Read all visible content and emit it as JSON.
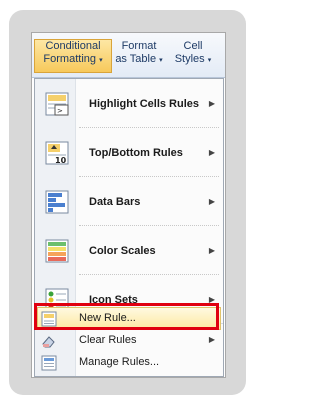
{
  "ribbon": {
    "conditional_formatting": {
      "line1": "Conditional",
      "line2": "Formatting"
    },
    "format_as_table": {
      "line1": "Format",
      "line2": "as Table"
    },
    "cell_styles": {
      "line1": "Cell",
      "line2": "Styles"
    },
    "dropdown_caret": "▾"
  },
  "menu": {
    "items": [
      {
        "label": "Highlight Cells Rules",
        "icon": "highlight-cells-rules-icon",
        "submenu_arrow": "▶"
      },
      {
        "label": "Top/Bottom Rules",
        "icon": "top-bottom-rules-icon",
        "submenu_arrow": "▶"
      },
      {
        "label": "Data Bars",
        "icon": "data-bars-icon",
        "submenu_arrow": "▶"
      },
      {
        "label": "Color Scales",
        "icon": "color-scales-icon",
        "submenu_arrow": "▶"
      },
      {
        "label": "Icon Sets",
        "icon": "icon-sets-icon",
        "submenu_arrow": "▶"
      }
    ],
    "small_items": [
      {
        "label": "New Rule...",
        "icon": "new-rule-icon",
        "highlighted": true
      },
      {
        "label": "Clear Rules",
        "icon": "clear-rules-icon",
        "submenu_arrow": "▶"
      },
      {
        "label": "Manage Rules...",
        "icon": "manage-rules-icon"
      }
    ]
  },
  "colors": {
    "highlight_box": "#e00010",
    "hover": "#fde9a2"
  }
}
